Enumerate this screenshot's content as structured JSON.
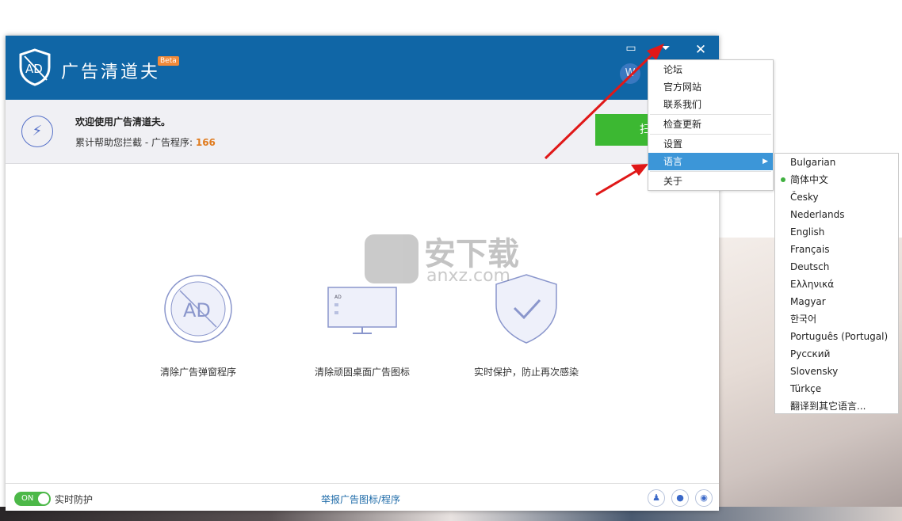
{
  "app": {
    "title": "广告清道夫",
    "badge": "Beta",
    "avatar_letter": "W"
  },
  "titlebar": {
    "feedback_icon": "message-icon",
    "menu_icon": "dropdown-icon",
    "close_icon": "close-icon"
  },
  "banner": {
    "welcome": "欢迎使用广告清道夫。",
    "stats_label": "累计帮助您拦截 -    广告程序:",
    "stats_count": "166",
    "scan_label": "扫描"
  },
  "features": [
    {
      "label": "清除广告弹窗程序"
    },
    {
      "label": "清除顽固桌面广告图标"
    },
    {
      "label": "实时保护，防止再次感染"
    }
  ],
  "footer": {
    "toggle": "ON",
    "toggle_label": "实时防护",
    "report_link": "举报广告图标/程序",
    "social": [
      "qq-icon",
      "wechat-icon",
      "weibo-icon"
    ]
  },
  "menu": {
    "items": [
      "论坛",
      "官方网站",
      "联系我们",
      "检查更新",
      "设置",
      "语言",
      "关于"
    ],
    "active": "语言"
  },
  "languages": {
    "items": [
      "Bulgarian",
      "简体中文",
      "Česky",
      "Nederlands",
      "English",
      "Français",
      "Deutsch",
      "Ελληνικά",
      "Magyar",
      "한국어",
      "Português (Portugal)",
      "Русский",
      "Slovensky",
      "Türkçe",
      "翻译到其它语言..."
    ],
    "selected": "简体中文"
  },
  "watermark": {
    "text": "安下载",
    "sub": "anxz.com"
  }
}
